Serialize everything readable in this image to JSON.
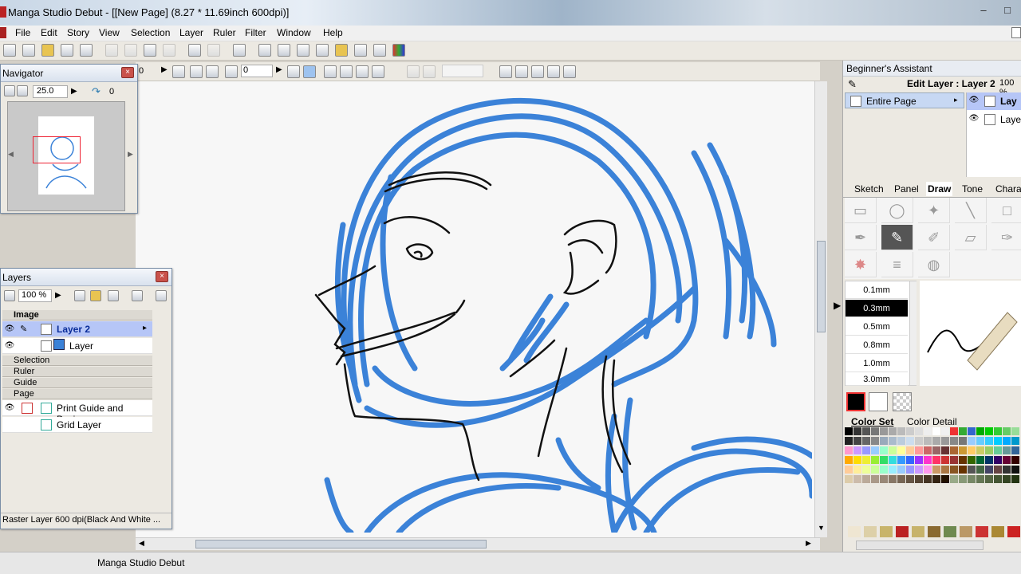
{
  "window": {
    "title": "Manga Studio Debut - [[New Page] (8.27 * 11.69inch 600dpi)]"
  },
  "menu": [
    "File",
    "Edit",
    "Story",
    "View",
    "Selection",
    "Layer",
    "Ruler",
    "Filter",
    "Window",
    "Help"
  ],
  "toolbar2": {
    "rotation_value": "0",
    "zoom_prefix": "0"
  },
  "navigator": {
    "title": "Navigator",
    "zoom": "25.0",
    "rotation": "0"
  },
  "layers": {
    "title": "Layers",
    "opacity": "100 %",
    "group_image": "Image",
    "items": [
      {
        "name": "Layer 2",
        "selected": true
      },
      {
        "name": "Layer",
        "selected": false
      }
    ],
    "groups": [
      "Selection",
      "Ruler",
      "Guide",
      "Page"
    ],
    "page_items": [
      "Print Guide and Basi...",
      "Grid Layer"
    ],
    "info": "Raster Layer 600 dpi(Black And White ..."
  },
  "assistant": {
    "title": "Beginner's Assistant",
    "edit_layer": "Edit Layer : Layer 2",
    "zoom": "100 %",
    "scope": "Entire Page",
    "layer_rows": [
      "Lay",
      "Laye"
    ],
    "tabs": [
      "Sketch",
      "Panel",
      "Draw",
      "Tone",
      "Charac"
    ],
    "active_tab": "Draw",
    "sizes": [
      "0.1mm",
      "0.3mm",
      "0.5mm",
      "0.8mm",
      "1.0mm",
      "3.0mm"
    ],
    "selected_size": "0.3mm",
    "color_tabs": [
      "Color Set",
      "Color Detail"
    ]
  },
  "status": {
    "app": "Manga Studio Debut"
  },
  "colors": {
    "stroke_blue": "#3b82d8",
    "layer_selected": "#b6c6f7",
    "close_red": "#c9524b"
  }
}
